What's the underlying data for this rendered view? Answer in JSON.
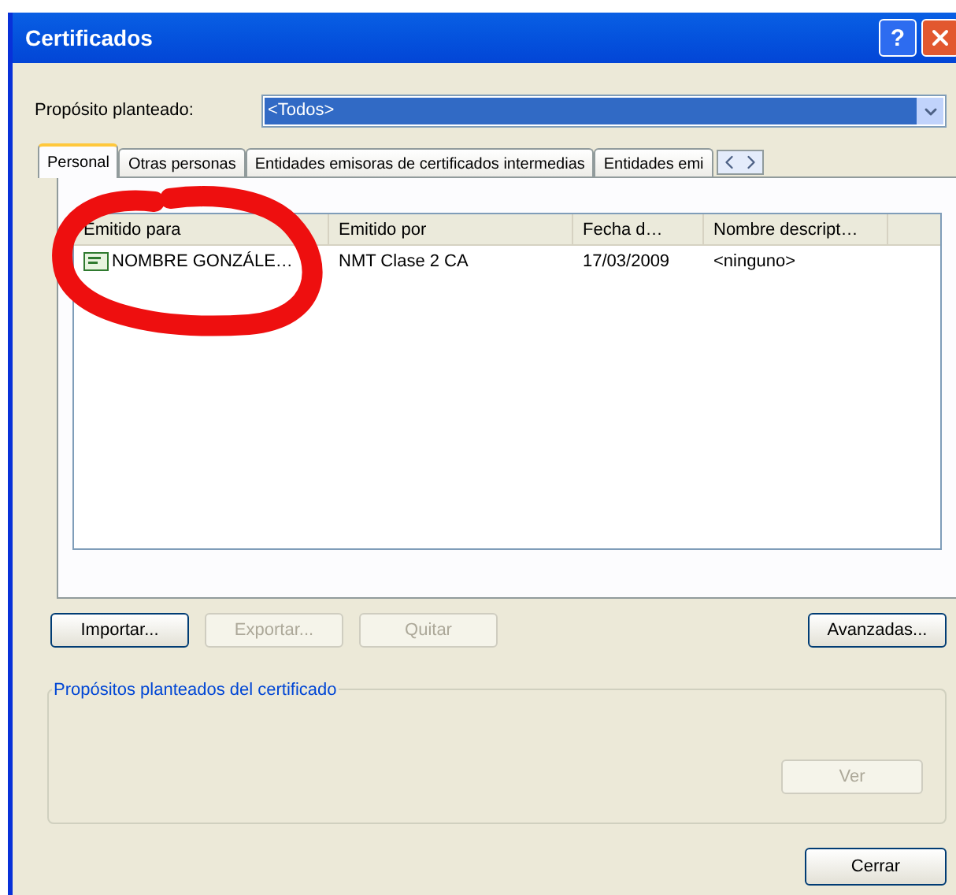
{
  "window": {
    "title": "Certificados",
    "help": "?"
  },
  "purpose": {
    "label": "Propósito planteado:",
    "value": "<Todos>"
  },
  "tabs": [
    {
      "label": "Personal",
      "selected": true
    },
    {
      "label": "Otras personas",
      "selected": false
    },
    {
      "label": "Entidades emisoras de certificados intermedias",
      "selected": false
    },
    {
      "label": "Entidades emi",
      "selected": false
    }
  ],
  "table": {
    "columns": [
      "Emitido para",
      "Emitido por",
      "Fecha d…",
      "Nombre descript…"
    ],
    "rows": [
      {
        "cells": [
          "NOMBRE GONZÁLE…",
          "NMT Clase 2 CA",
          "17/03/2009",
          "<ninguno>"
        ]
      }
    ]
  },
  "buttons": [
    {
      "label": "Importar...",
      "disabled": false
    },
    {
      "label": "Exportar...",
      "disabled": true
    },
    {
      "label": "Quitar",
      "disabled": true
    },
    {
      "label": "Avanzadas...",
      "disabled": false
    }
  ],
  "group": {
    "title": "Propósitos planteados del certificado",
    "button": {
      "label": "Ver",
      "disabled": true
    }
  },
  "close_button": {
    "label": "Cerrar",
    "disabled": false
  }
}
